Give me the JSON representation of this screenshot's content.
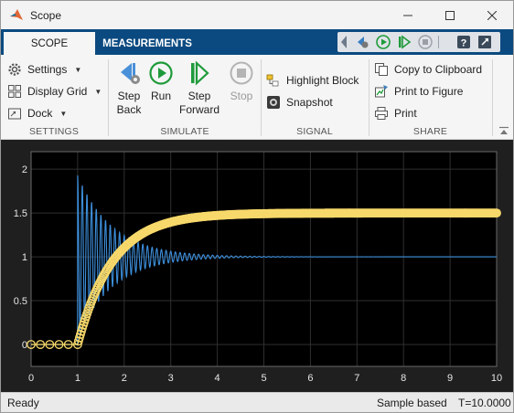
{
  "window": {
    "title": "Scope"
  },
  "tabs": [
    {
      "label": "SCOPE",
      "active": true
    },
    {
      "label": "MEASUREMENTS",
      "active": false
    }
  ],
  "quick_access": [
    "step-back-icon",
    "run-icon",
    "step-forward-icon",
    "stop-icon",
    "help-icon",
    "undock-icon"
  ],
  "ribbon": {
    "settings": {
      "label": "SETTINGS",
      "items": [
        {
          "label": "Settings",
          "icon": "gear-icon",
          "dropdown": true
        },
        {
          "label": "Display Grid",
          "icon": "grid-icon",
          "dropdown": true
        },
        {
          "label": "Dock",
          "icon": "dock-icon",
          "dropdown": true
        }
      ]
    },
    "simulate": {
      "label": "SIMULATE",
      "step_back": [
        "Step",
        "Back"
      ],
      "run": "Run",
      "step_forward": [
        "Step",
        "Forward"
      ],
      "stop": "Stop"
    },
    "signal": {
      "label": "SIGNAL",
      "highlight_block": "Highlight Block",
      "snapshot": "Snapshot"
    },
    "share": {
      "label": "SHARE",
      "copy": "Copy to Clipboard",
      "print_figure": "Print to Figure",
      "print": "Print"
    }
  },
  "status": {
    "state": "Ready",
    "mode": "Sample based",
    "time": "T=10.0000"
  },
  "colors": {
    "plot_background": "#1f1f1f",
    "series_oscillating": "#3d8fdc",
    "series_step": "#f7d86a",
    "tab_bar": "#0b4a80"
  },
  "chart_data": {
    "type": "line",
    "xlim": [
      0,
      10
    ],
    "ylim": [
      -0.25,
      2.2
    ],
    "xticks": [
      0,
      1,
      2,
      3,
      4,
      5,
      6,
      7,
      8,
      9,
      10
    ],
    "yticks": [
      0,
      0.5,
      1,
      1.5,
      2
    ],
    "grid": true,
    "series": [
      {
        "color": "#3d8fdc",
        "marker": "none",
        "description": "damped oscillation starting at t=1, settling at 1",
        "step_time": 1,
        "final_value": 1,
        "peak": 1.93,
        "oscillation_period": 0.1,
        "decay_time_constant": 0.75
      },
      {
        "color": "#f7d86a",
        "marker": "circle",
        "description": "first-order step response starting at t=1, rising to 1.5",
        "step_time": 1,
        "final_value": 1.5,
        "time_constant": 0.75
      }
    ]
  }
}
